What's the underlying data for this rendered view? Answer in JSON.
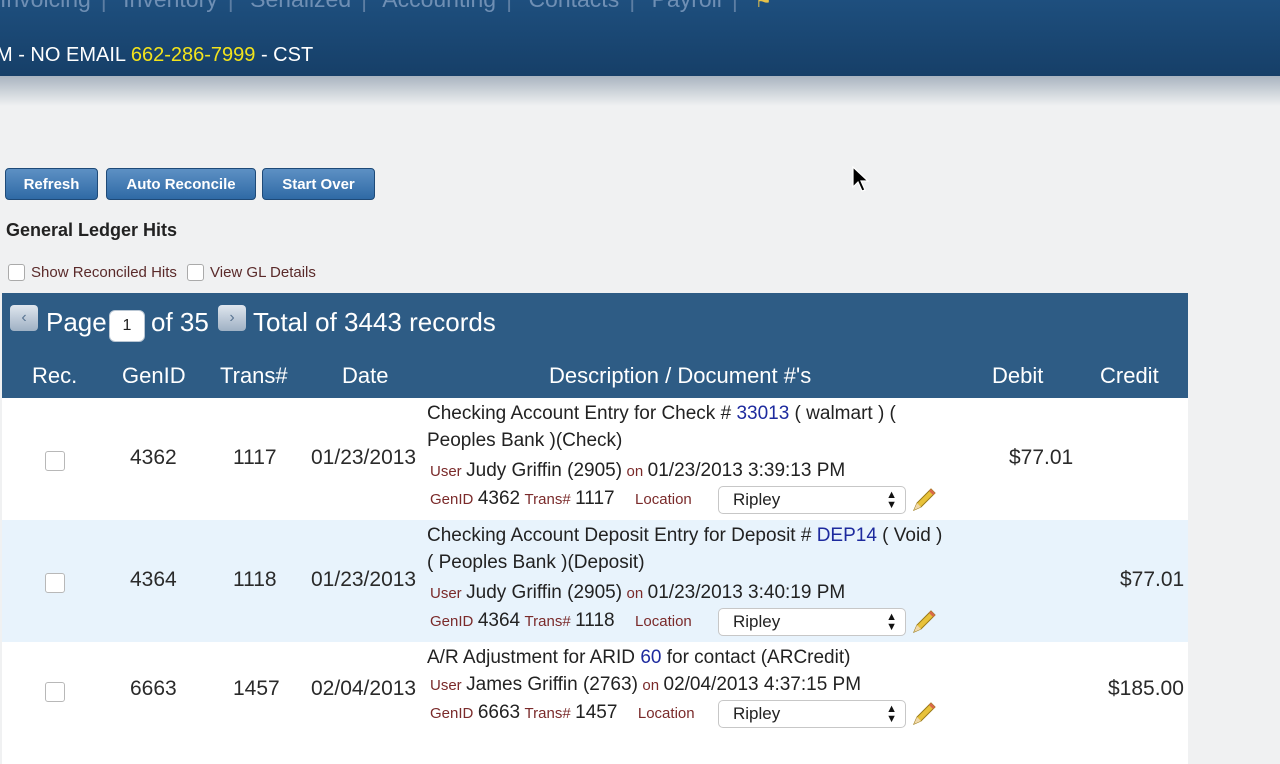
{
  "nav": {
    "items": [
      "Invoicing",
      "Inventory",
      "Serialized",
      "Accounting",
      "Contacts",
      "Payroll"
    ],
    "separator": "|",
    "end_icon": "home-icon"
  },
  "info": {
    "prefix": "M - NO EMAIL",
    "phone": "662-286-7999",
    "suffix": "- CST"
  },
  "toolbar": {
    "refresh_label": "Refresh",
    "auto_reconcile_label": "Auto Reconcile",
    "start_over_label": "Start Over"
  },
  "section_title": "General Ledger Hits",
  "options": {
    "show_reconciled_label": "Show Reconciled Hits",
    "view_gl_label": "View GL Details"
  },
  "pager": {
    "page_label": "Page",
    "current_page": "1",
    "of_label": "of 35",
    "total_label": "Total of 3443 records"
  },
  "columns": {
    "rec": "Rec.",
    "genid": "GenID",
    "trans": "Trans#",
    "date": "Date",
    "description": "Description / Document #'s",
    "debit": "Debit",
    "credit": "Credit"
  },
  "labels": {
    "user": "User",
    "on": "on",
    "genid": "GenID",
    "trans": "Trans#",
    "location": "Location"
  },
  "rows": [
    {
      "genid": "4362",
      "trans": "1117",
      "date": "01/23/2013",
      "desc_pre": "Checking Account Entry for Check # ",
      "desc_link": "33013",
      "desc_post": " ( walmart ) ( Peoples Bank )(Check)",
      "user": "Judy Griffin (2905)",
      "timestamp": "01/23/2013 3:39:13 PM",
      "location": "Ripley",
      "debit": "$77.01",
      "credit": ""
    },
    {
      "genid": "4364",
      "trans": "1118",
      "date": "01/23/2013",
      "desc_pre": "Checking Account Deposit Entry for Deposit # ",
      "desc_link": "DEP14",
      "desc_post": " ( Void ) ( Peoples Bank )(Deposit)",
      "user": "Judy Griffin (2905)",
      "timestamp": "01/23/2013 3:40:19 PM",
      "location": "Ripley",
      "debit": "",
      "credit": "$77.01"
    },
    {
      "genid": "6663",
      "trans": "1457",
      "date": "02/04/2013",
      "desc_pre": "A/R Adjustment for ARID ",
      "desc_link": "60",
      "desc_post": " for contact (ARCredit)",
      "user": "James Griffin (2763)",
      "timestamp": "02/04/2013 4:37:15 PM",
      "location": "Ripley",
      "debit": "",
      "credit": "$185.00"
    }
  ],
  "colors": {
    "header_bg": "#2e5c85",
    "alt_row_bg": "#e8f3fc",
    "link": "#1d2a9e",
    "phone": "#f2e31c"
  }
}
